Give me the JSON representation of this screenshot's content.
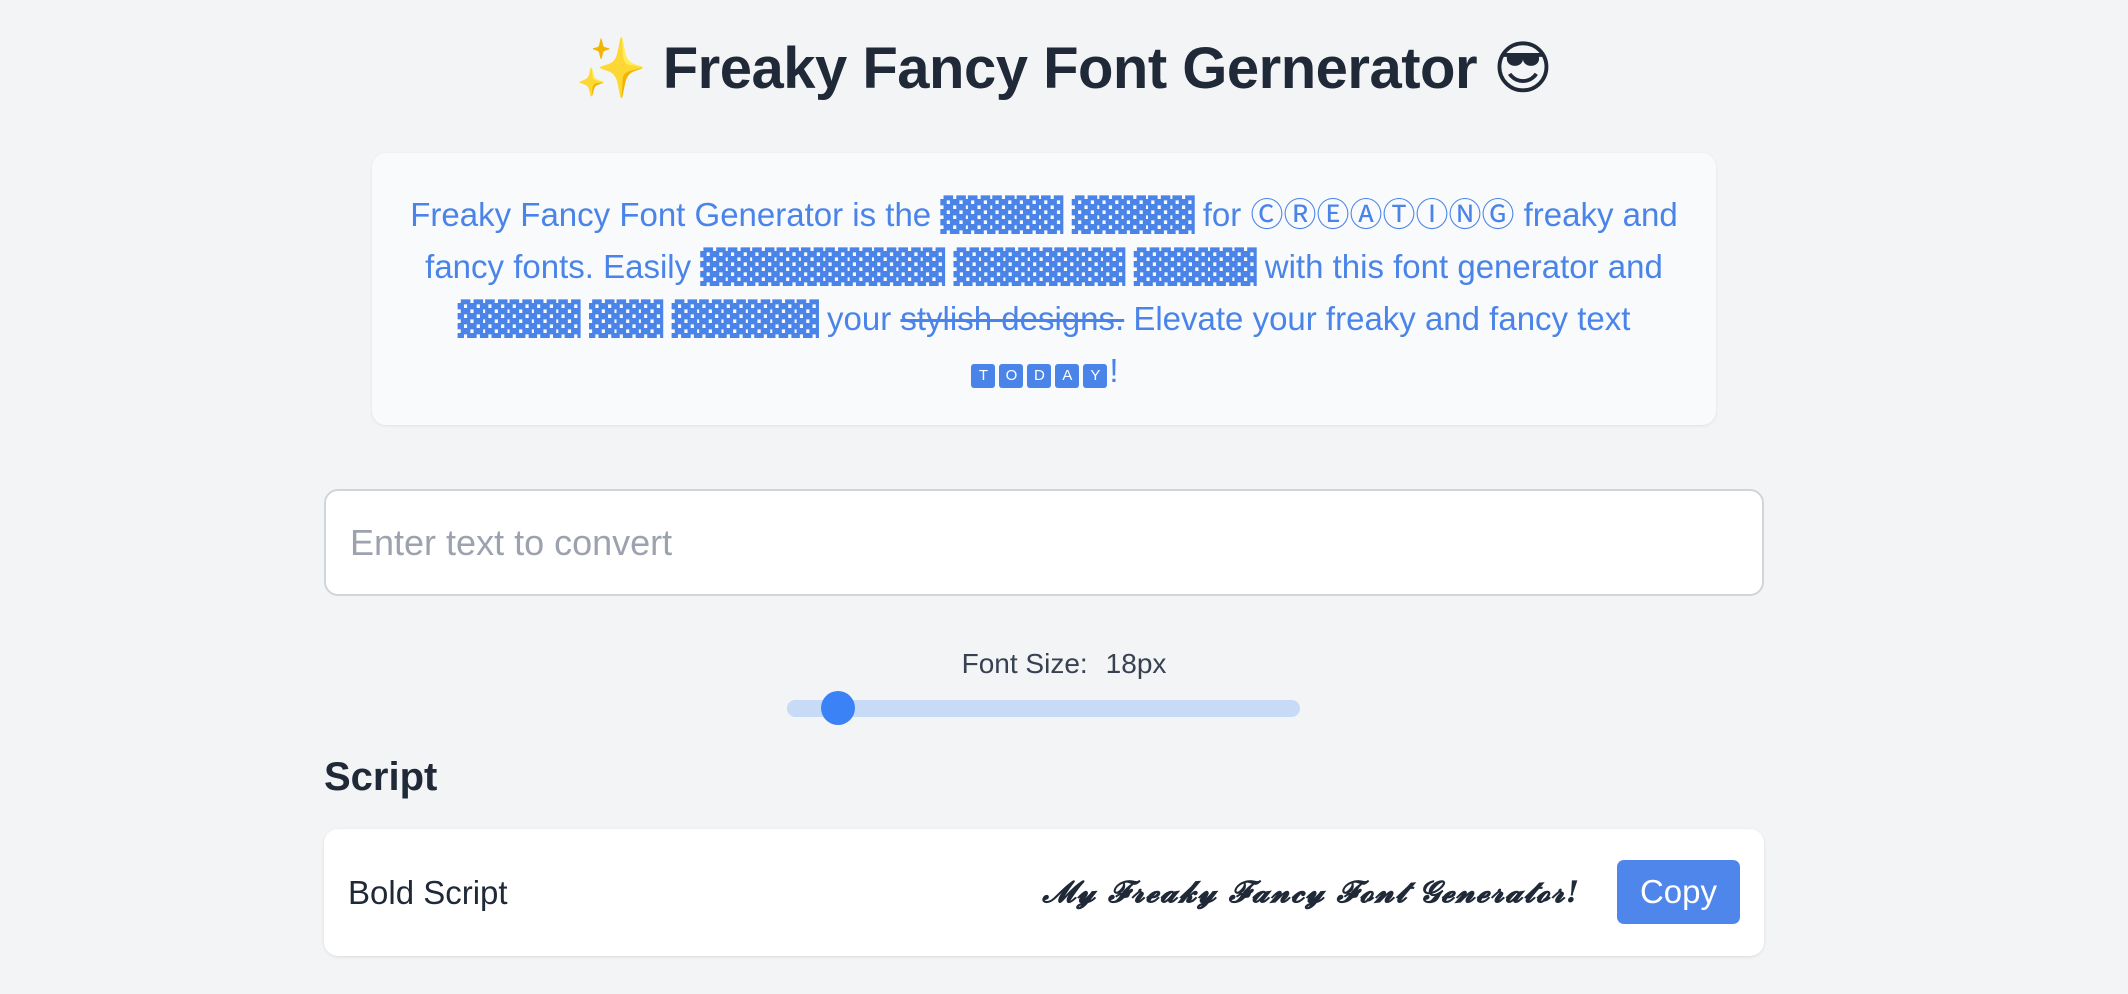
{
  "header": {
    "emoji_left": "✨",
    "title": "Freaky Fancy Font Gernerator",
    "emoji_right": "😎"
  },
  "intro": {
    "p1": "Freaky Fancy Font Generator is the ",
    "blk1": "▓▓▓▓▓ ▓▓▓▓▓",
    "p2": " for ",
    "circ": "ⒸⓇⒺⒶⓉⒾⓃⒼ",
    "p3": " freaky and fancy fonts. Easily ",
    "blk2": "▓▓▓▓▓▓▓▓▓▓ ▓▓▓▓▓▓▓ ▓▓▓▓▓",
    "p4": " with this font generator and ",
    "blk3": "▓▓▓▓▓ ▓▓▓ ▓▓▓▓▓▓",
    "p5": " your ",
    "strike": "stylish designs.",
    "p6": " Elevate your freaky and fancy text ",
    "today": [
      "T",
      "O",
      "D",
      "A",
      "Y"
    ],
    "end": "!"
  },
  "input": {
    "placeholder": "Enter text to convert",
    "value": ""
  },
  "font_size": {
    "label": "Font Size:",
    "value_text": "18px",
    "value": 18,
    "min": 12,
    "max": 72
  },
  "section": {
    "title": "Script"
  },
  "fonts": [
    {
      "name": "Bold Script",
      "preview": "𝓜𝔂 𝓕𝓻𝓮𝓪𝓴𝔂 𝓕𝓪𝓷𝓬𝔂 𝓕𝓸𝓷𝓽 𝓖𝓮𝓷𝓮𝓻𝓪𝓽𝓸𝓻!",
      "copy_label": "Copy"
    }
  ],
  "colors": {
    "accent": "#4f86ec",
    "intro_text": "#4a84e8",
    "slider_thumb": "#3b82f6",
    "slider_track": "#c7dbf7"
  }
}
